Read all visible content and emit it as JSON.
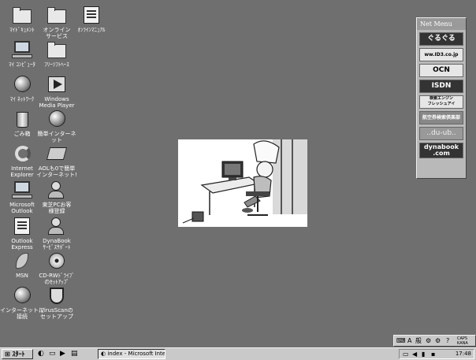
{
  "desktop": {
    "icons": [
      {
        "label": "ﾏｲﾄﾞｷｭﾒﾝﾄ",
        "icon": "folder-icon"
      },
      {
        "label": "オンライン\nサービス",
        "icon": "folder-icon"
      },
      {
        "label": "ｵﾝﾗｲﾝﾏﾆｭｱﾙ",
        "icon": "book-icon"
      },
      {
        "label": "ﾏｲ ｺﾝﾋﾟｭｰﾀ",
        "icon": "computer-icon"
      },
      {
        "label": "ﾌﾘｰｿﾌﾄﾍｰｽ",
        "icon": "folder-icon"
      },
      {
        "label": "ﾏｲ ﾈｯﾄﾜｰｸ",
        "icon": "network-icon"
      },
      {
        "label": "Windows\nMedia Player",
        "icon": "media-player-icon"
      },
      {
        "label": "ごみ箱",
        "icon": "recycle-bin-icon"
      },
      {
        "label": "簡単インターネ\nット",
        "icon": "globe-icon"
      },
      {
        "label": "Internet\nExplorer",
        "icon": "internet-explorer-icon"
      },
      {
        "label": "AOLも0で簡単\nインターネット!",
        "icon": "aol-icon"
      },
      {
        "label": "Microsoft\nOutlook",
        "icon": "outlook-icon"
      },
      {
        "label": "東芝PCお客\n様登録",
        "icon": "registration-icon"
      },
      {
        "label": "Outlook\nExpress",
        "icon": "outlook-express-icon"
      },
      {
        "label": "DynaBook\nｻｰﾋﾞｽｻﾎﾟｰﾄ",
        "icon": "support-icon"
      },
      {
        "label": "MSN",
        "icon": "msn-icon"
      },
      {
        "label": "CD-RWﾄﾞﾗｲﾌﾞ\nのｾｯﾄｱｯﾌﾟ",
        "icon": "cd-rw-icon"
      },
      {
        "label": "インターネットに\n接続",
        "icon": "connect-icon"
      },
      {
        "label": "VirusScanの\nセットアップ",
        "icon": "virusscan-icon"
      }
    ]
  },
  "net_menu": {
    "title": "Net Menu",
    "items": [
      "ぐるぐる",
      "ww.ID3.co.jp",
      "OCN",
      "ISDN",
      "検索エンジン\nフレッシュアイ",
      "航空券検索倶楽部",
      "..du-ub..",
      "dynabook\n.com"
    ]
  },
  "taskbar": {
    "start_label": "ｽﾀｰﾄ",
    "task_label": "index - Microsoft Interne..",
    "clock": "17:48"
  },
  "langbar": {
    "a_label": "A",
    "ime_label": "般",
    "caps_label": "CAPS\nKANA"
  },
  "colors": {
    "desktop": "#6f6f6f",
    "taskbar": "#c9c9c9"
  }
}
